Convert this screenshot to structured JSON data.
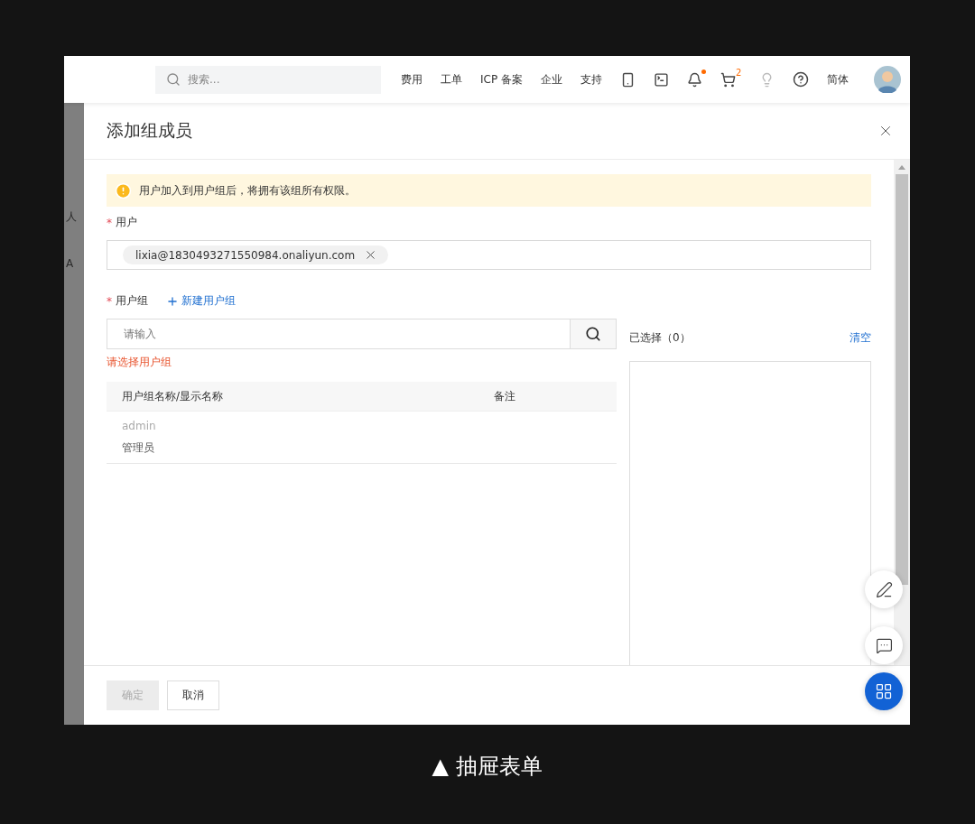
{
  "topbar": {
    "search": {
      "placeholder": "搜索..."
    },
    "nav": [
      "费用",
      "工单",
      "ICP 备案",
      "企业",
      "支持"
    ],
    "notifications": {
      "dot": true
    },
    "cart": {
      "badge": "2"
    },
    "language": "简体"
  },
  "backdrop_texts": [
    "人",
    "A"
  ],
  "drawer": {
    "title": "添加组成员",
    "alert": "用户加入到用户组后，将拥有该组所有权限。",
    "user_field": {
      "label": "用户",
      "required_mark": "*",
      "tags": [
        "lixia@1830493271550984.onaliyun.com"
      ]
    },
    "group_field": {
      "label": "用户组",
      "required_mark": "*",
      "create_link": "新建用户组",
      "search": {
        "placeholder": "请输入"
      },
      "error": "请选择用户组",
      "columns": [
        "用户组名称/显示名称",
        "备注"
      ],
      "rows": [
        {
          "name": "admin",
          "display_name": "管理员"
        }
      ]
    },
    "selected": {
      "label": "已选择（0）",
      "clear": "清空"
    },
    "buttons": [
      {
        "label": "确定",
        "disabled": true
      },
      {
        "label": "取消",
        "disabled": false
      }
    ]
  },
  "caption": "▲ 抽屉表单"
}
